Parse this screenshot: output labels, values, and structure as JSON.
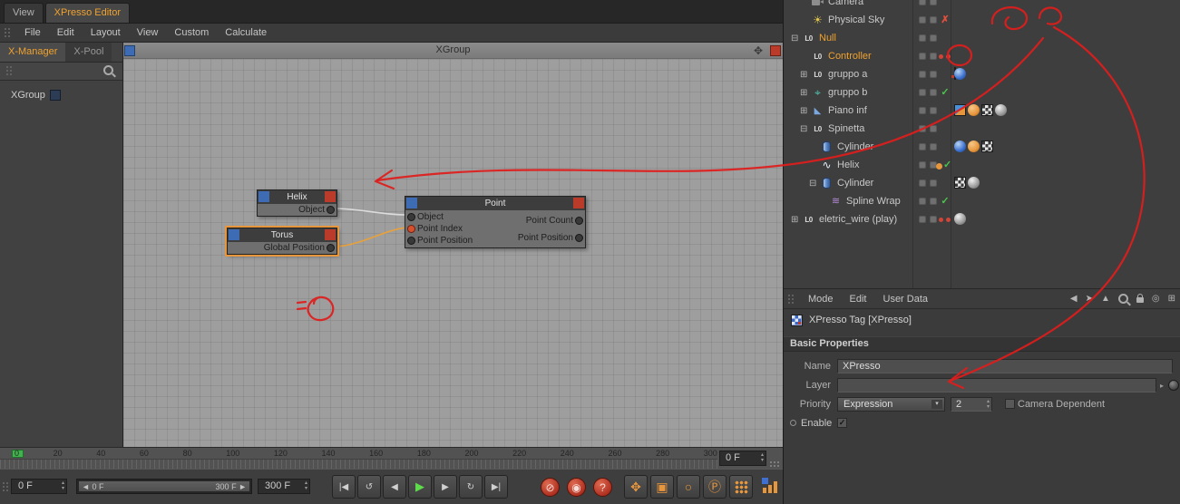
{
  "colors": {
    "accent_orange": "#f0a22e",
    "selection_orange": "#e8963c",
    "annotation_red": "#e11c1c",
    "play_green": "#5fdc4b"
  },
  "glyphs": {
    "expand": "⊞",
    "collapse": "⊟",
    "check": "✓",
    "cross": "✗",
    "dropdown_arrow": "▾",
    "spinner_up": "▴",
    "spinner_down": "▾",
    "slider_left": "◄",
    "slider_right": "►",
    "canvas_move": "✥",
    "attr_menu_icons": [
      {
        "name": "history-back-icon",
        "glyph": "◀"
      },
      {
        "name": "pick-icon",
        "glyph": "➤"
      },
      {
        "name": "up-icon",
        "glyph": "▲"
      },
      {
        "name": "search-icon",
        "glyph": "css-mag"
      },
      {
        "name": "lock-icon",
        "glyph": "css-lock"
      },
      {
        "name": "target-icon",
        "glyph": "◎"
      },
      {
        "name": "new-panel-icon",
        "glyph": "⊞"
      }
    ]
  },
  "xpresso": {
    "window_tabs": [
      {
        "label": "View",
        "active": false
      },
      {
        "label": "XPresso Editor",
        "active": true
      }
    ],
    "menu": [
      "File",
      "Edit",
      "Layout",
      "View",
      "Custom",
      "Calculate"
    ],
    "panel_tabs": [
      {
        "label": "X-Manager",
        "active": true
      },
      {
        "label": "X-Pool",
        "active": false
      }
    ],
    "tree_items": [
      "XGroup"
    ],
    "canvas_title": "XGroup",
    "nodes": {
      "helix": {
        "title": "Helix",
        "outputs": [
          "Object"
        ]
      },
      "point": {
        "title": "Point",
        "inputs": [
          "Object",
          "Point Index",
          "Point Position"
        ],
        "outputs": [
          "Point Count",
          "Point Position"
        ]
      },
      "torus": {
        "title": "Torus",
        "outputs": [
          "Global Position"
        ],
        "selected": true
      }
    }
  },
  "ruler": {
    "numbers": [
      "0",
      "20",
      "40",
      "60",
      "80",
      "100",
      "120",
      "140",
      "160",
      "180",
      "200",
      "220",
      "240",
      "260",
      "280",
      "300"
    ],
    "frame_field": "0 F"
  },
  "timeline": {
    "current_frame": "0 F",
    "end_frame": "300 F",
    "range_start": "0 F",
    "range_end": "300 F",
    "transport": [
      {
        "name": "goto-start",
        "glyph": "|◀"
      },
      {
        "name": "play-backward",
        "glyph": "↺"
      },
      {
        "name": "previous-frame",
        "glyph": "◀"
      },
      {
        "name": "play-forward",
        "glyph": "▶",
        "green": true
      },
      {
        "name": "next-frame",
        "glyph": "▶"
      },
      {
        "name": "loop",
        "glyph": "↻"
      },
      {
        "name": "goto-end",
        "glyph": "▶|"
      }
    ],
    "record": [
      {
        "name": "record-active-objects",
        "glyph": "⊘"
      },
      {
        "name": "autokeying",
        "glyph": "◉"
      },
      {
        "name": "keyframe-selection",
        "glyph": "?"
      }
    ],
    "key_toggles": [
      {
        "name": "keyframe-position",
        "glyph": "✥"
      },
      {
        "name": "keyframe-scale",
        "glyph": "▣"
      },
      {
        "name": "keyframe-rotation",
        "glyph": "○"
      },
      {
        "name": "keyframe-parameter",
        "glyph": "Ⓟ"
      },
      {
        "name": "keyframe-pla",
        "glyph": "",
        "dots": true
      }
    ]
  },
  "object_manager": {
    "rows": [
      {
        "label": "Camera",
        "icon": "camera",
        "indent": 1,
        "expander": ""
      },
      {
        "label": "Physical Sky",
        "icon": "sun",
        "indent": 1,
        "expander": "",
        "status": "x"
      },
      {
        "label": "Null",
        "icon": "null",
        "indent": 0,
        "expander": "minus",
        "highlight": true
      },
      {
        "label": "Controller",
        "icon": "null",
        "indent": 1,
        "expander": "",
        "highlight": true,
        "status": "reddots",
        "tags": [
          "xpresso"
        ]
      },
      {
        "label": "gruppo a",
        "icon": "null",
        "indent": 1,
        "expander": "plus",
        "tags": [
          "sphere-blue"
        ]
      },
      {
        "label": "gruppo b",
        "icon": "axis",
        "indent": 1,
        "expander": "plus",
        "status": "check"
      },
      {
        "label": "Piano inf",
        "icon": "plane",
        "indent": 1,
        "expander": "plus",
        "tags": [
          "pair",
          "dot-orange",
          "checker",
          "sphere-gray"
        ]
      },
      {
        "label": "Spinetta",
        "icon": "null",
        "indent": 1,
        "expander": "minus"
      },
      {
        "label": "Cylinder",
        "icon": "cylinder",
        "indent": 2,
        "expander": ""
      },
      {
        "label": "Helix",
        "icon": "helix",
        "indent": 2,
        "expander": "",
        "status": "dotcheck"
      },
      {
        "label": "Cylinder",
        "icon": "cylinder",
        "indent": 2,
        "expander": "minus",
        "tags": [
          "checker",
          "sphere-gray"
        ]
      },
      {
        "label": "Spline Wrap",
        "icon": "wrap",
        "indent": 3,
        "expander": "",
        "status": "check"
      },
      {
        "label": "eletric_wire (play)",
        "icon": "null",
        "indent": 0,
        "expander": "plus",
        "status": "reddots",
        "tags": [
          "sphere-gray"
        ]
      }
    ],
    "row2_tags_note": "Cylinder row tags",
    "cylinder1_tags": [
      "sphere-blue",
      "dot-orange",
      "checker"
    ]
  },
  "attributes": {
    "menu": [
      "Mode",
      "Edit",
      "User Data"
    ],
    "title": "XPresso Tag [XPresso]",
    "section": "Basic Properties",
    "name_label": "Name",
    "name_value": "XPresso",
    "layer_label": "Layer",
    "layer_value": "",
    "priority_label": "Priority",
    "priority_value": "Expression",
    "priority_number": "2",
    "camera_dependent_label": "Camera Dependent",
    "camera_dependent_checked": false,
    "enable_label": "Enable",
    "enable_checked": true
  }
}
